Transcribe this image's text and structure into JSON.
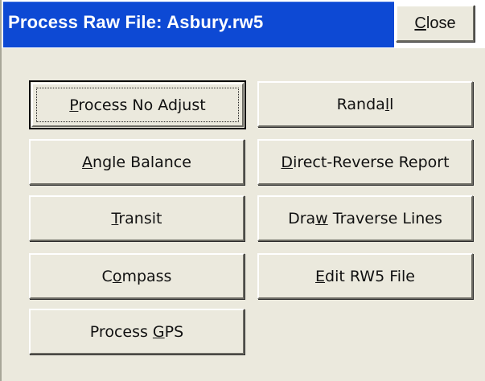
{
  "window": {
    "title": "Process Raw File: Asbury.rw5"
  },
  "titlebar": {
    "close_label_before": "",
    "close_mnemonic": "C",
    "close_label_after": "lose"
  },
  "buttons": {
    "process_no_adjust": {
      "before": "",
      "mnemonic": "P",
      "after": "rocess No Adjust"
    },
    "angle_balance": {
      "before": "",
      "mnemonic": "A",
      "after": "ngle Balance"
    },
    "transit": {
      "before": "",
      "mnemonic": "T",
      "after": "ransit"
    },
    "compass": {
      "before": "C",
      "mnemonic": "o",
      "after": "mpass"
    },
    "process_gps": {
      "before": "Process ",
      "mnemonic": "G",
      "after": "PS"
    },
    "crandall": {
      "before": "Randa",
      "mnemonic": "l",
      "after": "l"
    },
    "direct_reverse_report": {
      "before": "",
      "mnemonic": "D",
      "after": "irect-Reverse Report"
    },
    "draw_traverse_lines": {
      "before": "Dra",
      "mnemonic": "w",
      "after": " Traverse Lines"
    },
    "edit_rw5_file": {
      "before": "",
      "mnemonic": "E",
      "after": "dit RW5 File"
    }
  }
}
